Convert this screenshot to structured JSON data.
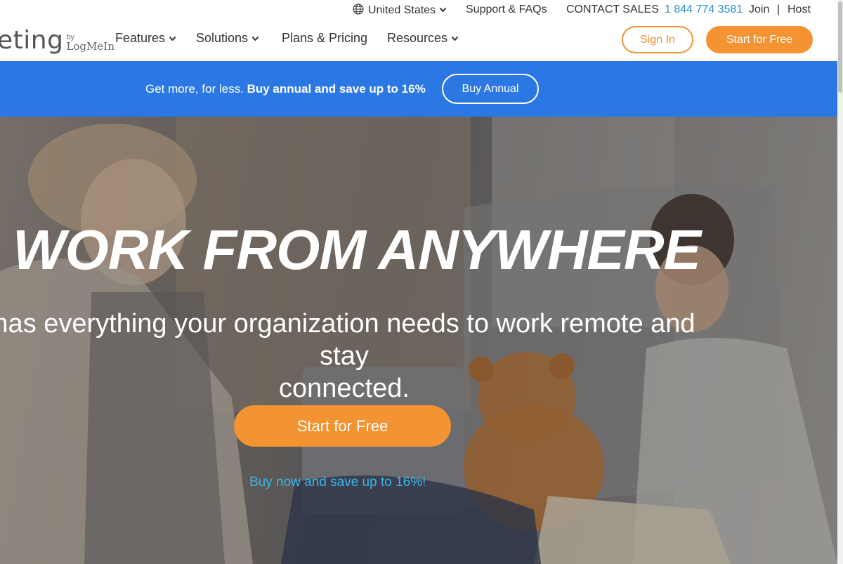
{
  "utility": {
    "region": "United States",
    "support": "Support & FAQs",
    "contact_sales": "CONTACT SALES",
    "phone": "1 844 774 3581",
    "join": "Join",
    "separator": "|",
    "host": "Host"
  },
  "logo": {
    "word": "eting",
    "by": "by",
    "brand": "LogMeIn"
  },
  "nav": {
    "items": [
      {
        "label": "Features"
      },
      {
        "label": "Solutions"
      },
      {
        "label": "Plans & Pricing"
      },
      {
        "label": "Resources"
      }
    ],
    "sign_in": "Sign In",
    "start_free": "Start for Free"
  },
  "promo": {
    "text": "Get more, for less.",
    "bold_text": "Buy annual and save up to 16%",
    "button": "Buy Annual"
  },
  "hero": {
    "title": "WORK FROM ANYWHERE",
    "subtitle_line1": "has everything your organization needs to work remote and stay",
    "subtitle_line2": "connected.",
    "cta": "Start for Free",
    "link": "Buy now and save up to 16%!"
  },
  "colors": {
    "accent_orange": "#f39332",
    "banner_blue": "#2b78e4",
    "link_blue": "#3ab5e8",
    "phone_blue": "#2a8fd6"
  },
  "icons": [
    "globe-icon",
    "chevron-down-icon"
  ]
}
